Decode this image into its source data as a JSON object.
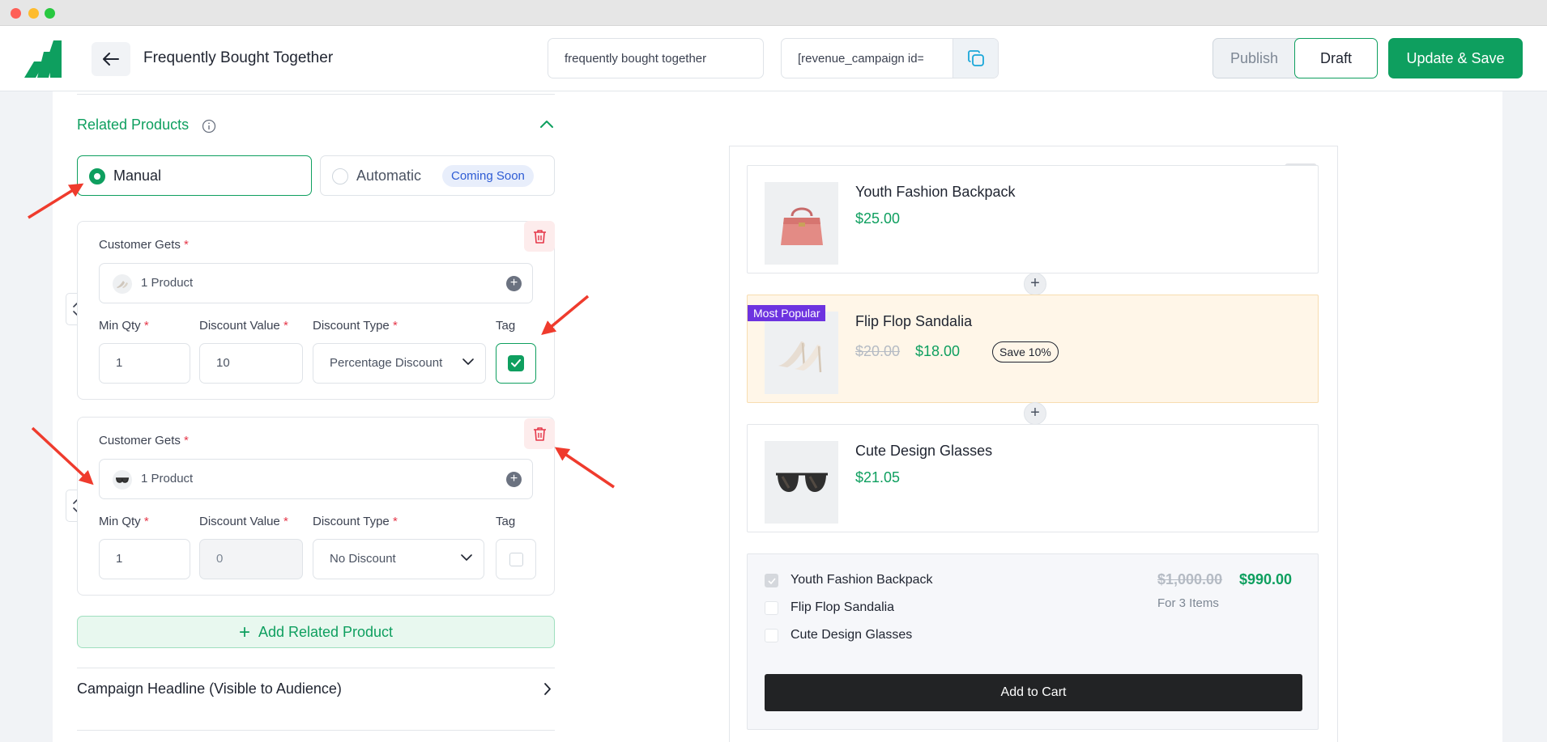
{
  "header": {
    "title": "Frequently Bought Together",
    "campaign_name_value": "frequently bought together",
    "shortcode_value": "[revenue_campaign id='",
    "publish_label": "Publish",
    "draft_label": "Draft",
    "save_label": "Update & Save"
  },
  "related_products": {
    "title": "Related Products",
    "mode_manual": "Manual",
    "mode_automatic": "Automatic",
    "coming_soon": "Coming Soon",
    "rows": [
      {
        "customer_gets_label": "Customer Gets",
        "product_text": "1 Product",
        "min_qty_label": "Min Qty",
        "min_qty_value": "1",
        "discount_value_label": "Discount Value",
        "discount_value": "10",
        "discount_type_label": "Discount Type",
        "discount_type_value": "Percentage Discount",
        "tag_label": "Tag",
        "tag_checked": true
      },
      {
        "customer_gets_label": "Customer Gets",
        "product_text": "1 Product",
        "min_qty_label": "Min Qty",
        "min_qty_value": "1",
        "discount_value_label": "Discount Value",
        "discount_value": "0",
        "discount_type_label": "Discount Type",
        "discount_type_value": "No Discount",
        "tag_label": "Tag",
        "tag_checked": false
      }
    ],
    "required_mark": "*",
    "add_label": "Add Related Product"
  },
  "campaign_headline": {
    "label": "Campaign Headline (Visible to Audience)"
  },
  "preview": {
    "products": [
      {
        "name": "Youth Fashion Backpack",
        "price": "$25.00"
      },
      {
        "name": "Flip Flop Sandalia",
        "old_price": "$20.00",
        "price": "$18.00",
        "save_tag": "Save 10%",
        "badge": "Most Popular"
      },
      {
        "name": "Cute Design Glasses",
        "price": "$21.05"
      }
    ],
    "plus_symbol": "+",
    "summary": {
      "items": [
        "Youth Fashion Backpack",
        "Flip Flop Sandalia",
        "Cute Design Glasses"
      ],
      "total_old": "$1,000.00",
      "total_new": "$990.00",
      "items_count": "For 3 Items",
      "cart_label": "Add to Cart"
    }
  },
  "colors": {
    "accent": "#0e9f5f",
    "danger": "#e5384a",
    "badge_purple": "#6d33e0",
    "annotation_arrow": "#ef3b2d"
  }
}
